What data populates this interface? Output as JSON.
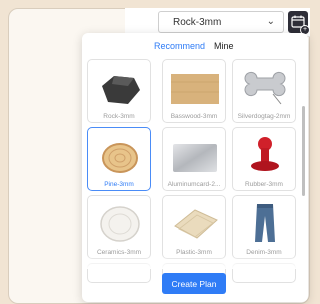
{
  "toolbar": {
    "material_select": "Rock-3mm"
  },
  "panel": {
    "tabs": [
      {
        "label": "Recommend",
        "active": true
      },
      {
        "label": "Mine",
        "active": false
      }
    ],
    "materials": [
      {
        "label": "Rock-3mm",
        "icon": "slate-rock-icon",
        "selected": false
      },
      {
        "label": "Basswood-3mm",
        "icon": "wood-board-icon",
        "selected": false
      },
      {
        "label": "Silverdogtag-2mm",
        "icon": "dog-tag-icon",
        "selected": false
      },
      {
        "label": "Pine-3mm",
        "icon": "pine-slice-icon",
        "selected": true
      },
      {
        "label": "Aluminumcard-2...",
        "icon": "aluminum-card-icon",
        "selected": false
      },
      {
        "label": "Rubber-3mm",
        "icon": "rubber-stamp-icon",
        "selected": false
      },
      {
        "label": "Ceramics-3mm",
        "icon": "ceramic-plate-icon",
        "selected": false
      },
      {
        "label": "Plastic-3mm",
        "icon": "plastic-sheet-icon",
        "selected": false
      },
      {
        "label": "Denim-3mm",
        "icon": "denim-jeans-icon",
        "selected": false
      }
    ],
    "create_button": "Create Plan"
  },
  "colors": {
    "accent": "#2f7cf6",
    "background": "#f1e4d3"
  }
}
